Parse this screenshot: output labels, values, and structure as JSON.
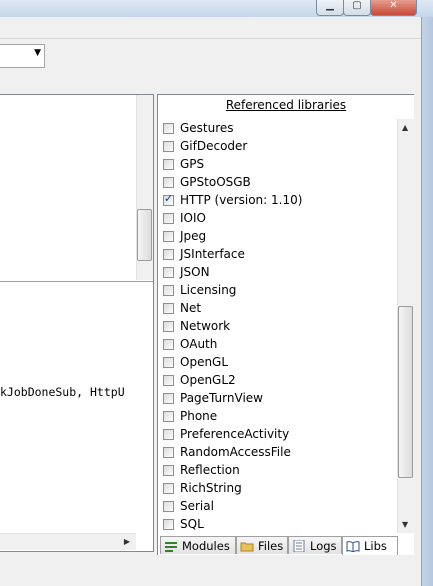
{
  "window": {
    "minimize_glyph": "▁",
    "maximize_glyph": "▢",
    "close_glyph": "✕"
  },
  "combo": {
    "arrow": "▼"
  },
  "editor": {
    "code_fragment": "kJobDoneSub, HttpU"
  },
  "libraries": {
    "title": "Referenced libraries",
    "items": [
      {
        "label": "Gestures",
        "checked": false
      },
      {
        "label": "GifDecoder",
        "checked": false
      },
      {
        "label": "GPS",
        "checked": false
      },
      {
        "label": "GPStoOSGB",
        "checked": false
      },
      {
        "label": "HTTP (version: 1.10)",
        "checked": true
      },
      {
        "label": "IOIO",
        "checked": false
      },
      {
        "label": "Jpeg",
        "checked": false
      },
      {
        "label": "JSInterface",
        "checked": false
      },
      {
        "label": "JSON",
        "checked": false
      },
      {
        "label": "Licensing",
        "checked": false
      },
      {
        "label": "Net",
        "checked": false
      },
      {
        "label": "Network",
        "checked": false
      },
      {
        "label": "OAuth",
        "checked": false
      },
      {
        "label": "OpenGL",
        "checked": false
      },
      {
        "label": "OpenGL2",
        "checked": false
      },
      {
        "label": "PageTurnView",
        "checked": false
      },
      {
        "label": "Phone",
        "checked": false
      },
      {
        "label": "PreferenceActivity",
        "checked": false
      },
      {
        "label": "RandomAccessFile",
        "checked": false
      },
      {
        "label": "Reflection",
        "checked": false
      },
      {
        "label": "RichString",
        "checked": false
      },
      {
        "label": "Serial",
        "checked": false
      },
      {
        "label": "SQL",
        "checked": false
      }
    ]
  },
  "tabs": [
    {
      "label": "Modules",
      "icon": "modules-icon"
    },
    {
      "label": "Files",
      "icon": "folder-icon"
    },
    {
      "label": "Logs",
      "icon": "logs-icon"
    },
    {
      "label": "Libs",
      "icon": "book-icon",
      "active": true
    }
  ],
  "colors": {
    "accent": "#1b3f8a",
    "frame": "#c9d9ea"
  }
}
